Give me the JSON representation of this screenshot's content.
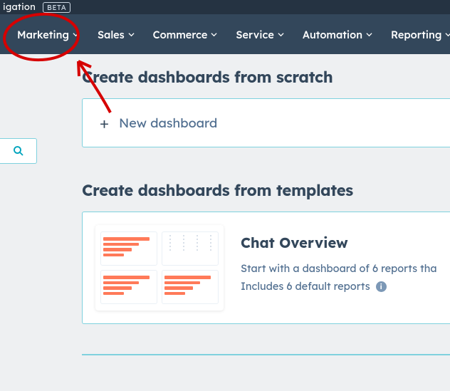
{
  "topstrip": {
    "label": "igation",
    "badge": "BETA"
  },
  "nav": {
    "items": [
      {
        "label": "Marketing"
      },
      {
        "label": "Sales"
      },
      {
        "label": "Commerce"
      },
      {
        "label": "Service"
      },
      {
        "label": "Automation"
      },
      {
        "label": "Reporting"
      }
    ]
  },
  "section_scratch": {
    "title": "Create dashboards from scratch",
    "new_label": "New dashboard"
  },
  "section_templates": {
    "title": "Create dashboards from templates",
    "cards": [
      {
        "name": "Chat Overview",
        "desc": "Start with a dashboard of 6 reports tha",
        "includes": "Includes 6 default reports"
      }
    ]
  },
  "colors": {
    "accent_border": "#7fd1de",
    "nav_bg": "#33475b",
    "heading": "#33475b",
    "muted_text": "#516f90",
    "chart_bar": "#ff7a59",
    "annotation": "#d60000"
  }
}
